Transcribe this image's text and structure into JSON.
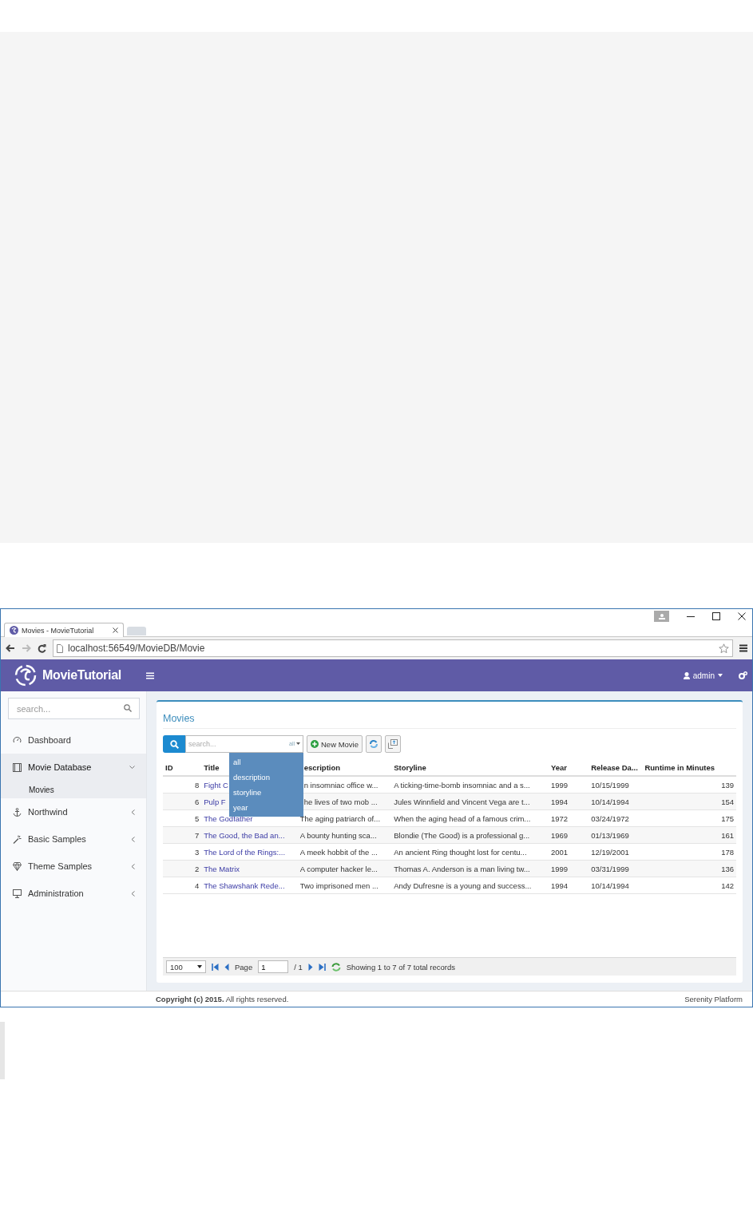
{
  "browser": {
    "tab": {
      "title": "Movies - MovieTutorial"
    },
    "address": "localhost:56549/MovieDB/Movie"
  },
  "app": {
    "brand": "MovieTutorial",
    "user": "admin"
  },
  "sidebar": {
    "search_placeholder": "search...",
    "items": [
      {
        "kind": "link",
        "label": "Dashboard",
        "selected": false
      },
      {
        "kind": "group",
        "label": "Movie Database",
        "expanded": true,
        "selected": true,
        "children": [
          {
            "label": "Movies"
          }
        ]
      },
      {
        "kind": "group",
        "label": "Northwind",
        "expanded": false,
        "selected": false
      },
      {
        "kind": "group",
        "label": "Basic Samples",
        "expanded": false,
        "selected": false
      },
      {
        "kind": "group",
        "label": "Theme Samples",
        "expanded": false,
        "selected": false
      },
      {
        "kind": "group",
        "label": "Administration",
        "expanded": false,
        "selected": false
      }
    ]
  },
  "page": {
    "title": "Movies",
    "search": {
      "placeholder": "search...",
      "field": "all"
    },
    "field_menu": [
      {
        "label": "all"
      },
      {
        "label": "description"
      },
      {
        "label": "storyline"
      },
      {
        "label": "year"
      }
    ],
    "new_button": "New Movie",
    "table": {
      "columns": [
        "ID",
        "Title",
        "escription",
        "Storyline",
        "Year",
        "Release Da...",
        "Runtime in Minutes"
      ],
      "rows": [
        [
          "8",
          "Fight C",
          "n insomniac office w...",
          "A ticking-time-bomb insomniac and a s...",
          "1999",
          "10/15/1999",
          "139"
        ],
        [
          "6",
          "Pulp F",
          "he lives of two mob ...",
          "Jules Winnfield and Vincent Vega are t...",
          "1994",
          "10/14/1994",
          "154"
        ],
        [
          "5",
          "The Godfather",
          "The aging patriarch of...",
          "When the aging head of a famous crim...",
          "1972",
          "03/24/1972",
          "175"
        ],
        [
          "7",
          "The Good, the Bad an...",
          "A bounty hunting sca...",
          "Blondie (The Good) is a professional g...",
          "1969",
          "01/13/1969",
          "161"
        ],
        [
          "3",
          "The Lord of the Rings:...",
          "A meek hobbit of the ...",
          "An ancient Ring thought lost for centu...",
          "2001",
          "12/19/2001",
          "178"
        ],
        [
          "2",
          "The Matrix",
          "A computer hacker le...",
          "Thomas A. Anderson is a man living tw...",
          "1999",
          "03/31/1999",
          "136"
        ],
        [
          "4",
          "The Shawshank Rede...",
          "Two imprisoned men ...",
          "Andy Dufresne is a young and success...",
          "1994",
          "10/14/1994",
          "142"
        ]
      ]
    },
    "pager": {
      "page_size": "100",
      "page_label": "Page",
      "page": "1",
      "page_total": "/ 1",
      "status": "Showing 1 to 7 of 7 total records"
    }
  },
  "footer": {
    "copyright": "**Copyright (c) 2015.** All rights reserved.",
    "platform": "Serenity Platform"
  }
}
